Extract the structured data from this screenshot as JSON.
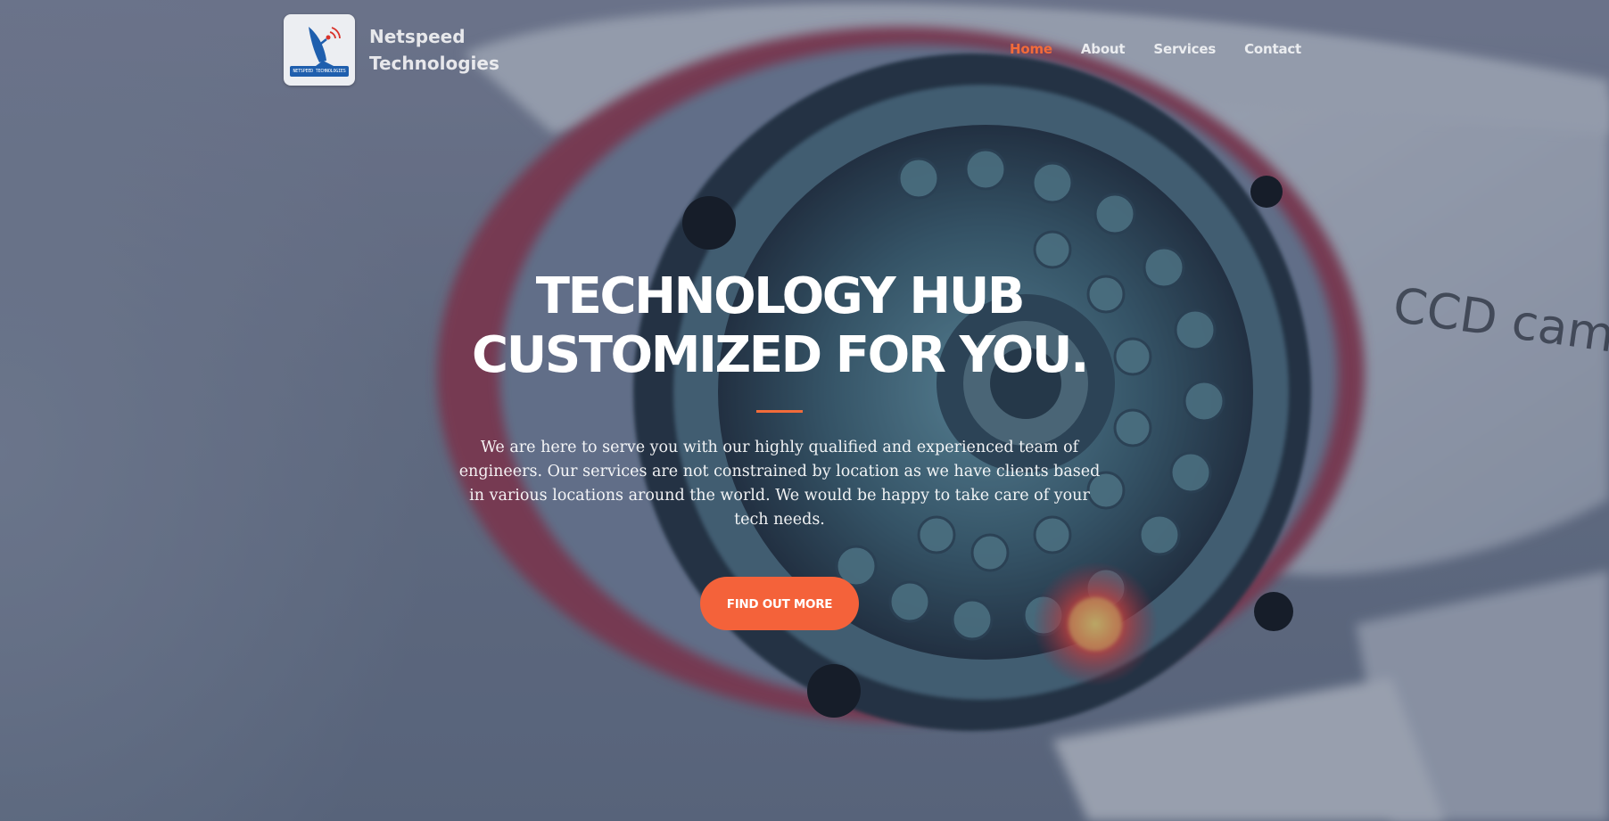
{
  "brand": {
    "name": "Netspeed Technologies",
    "logo_text": "NETSPEED TECHNOLOGIES"
  },
  "nav": {
    "items": [
      {
        "label": "Home",
        "active": true
      },
      {
        "label": "About",
        "active": false
      },
      {
        "label": "Services",
        "active": false
      },
      {
        "label": "Contact",
        "active": false
      }
    ]
  },
  "hero": {
    "title": "TECHNOLOGY HUB CUSTOMIZED FOR YOU.",
    "description": "We are here to serve you with our highly qualified and experienced team of engineers. Our services are not constrained by location as we have clients based in various locations around the world. We would be happy to take care of your tech needs.",
    "cta_label": "FIND OUT MORE",
    "background_label": "CCD camera"
  },
  "colors": {
    "accent": "#f4623a",
    "nav_active": "#f26b3a",
    "text": "#ffffff",
    "logo_blue": "#1f5fae"
  },
  "icons": {
    "logo": "satellite-dish-icon"
  }
}
